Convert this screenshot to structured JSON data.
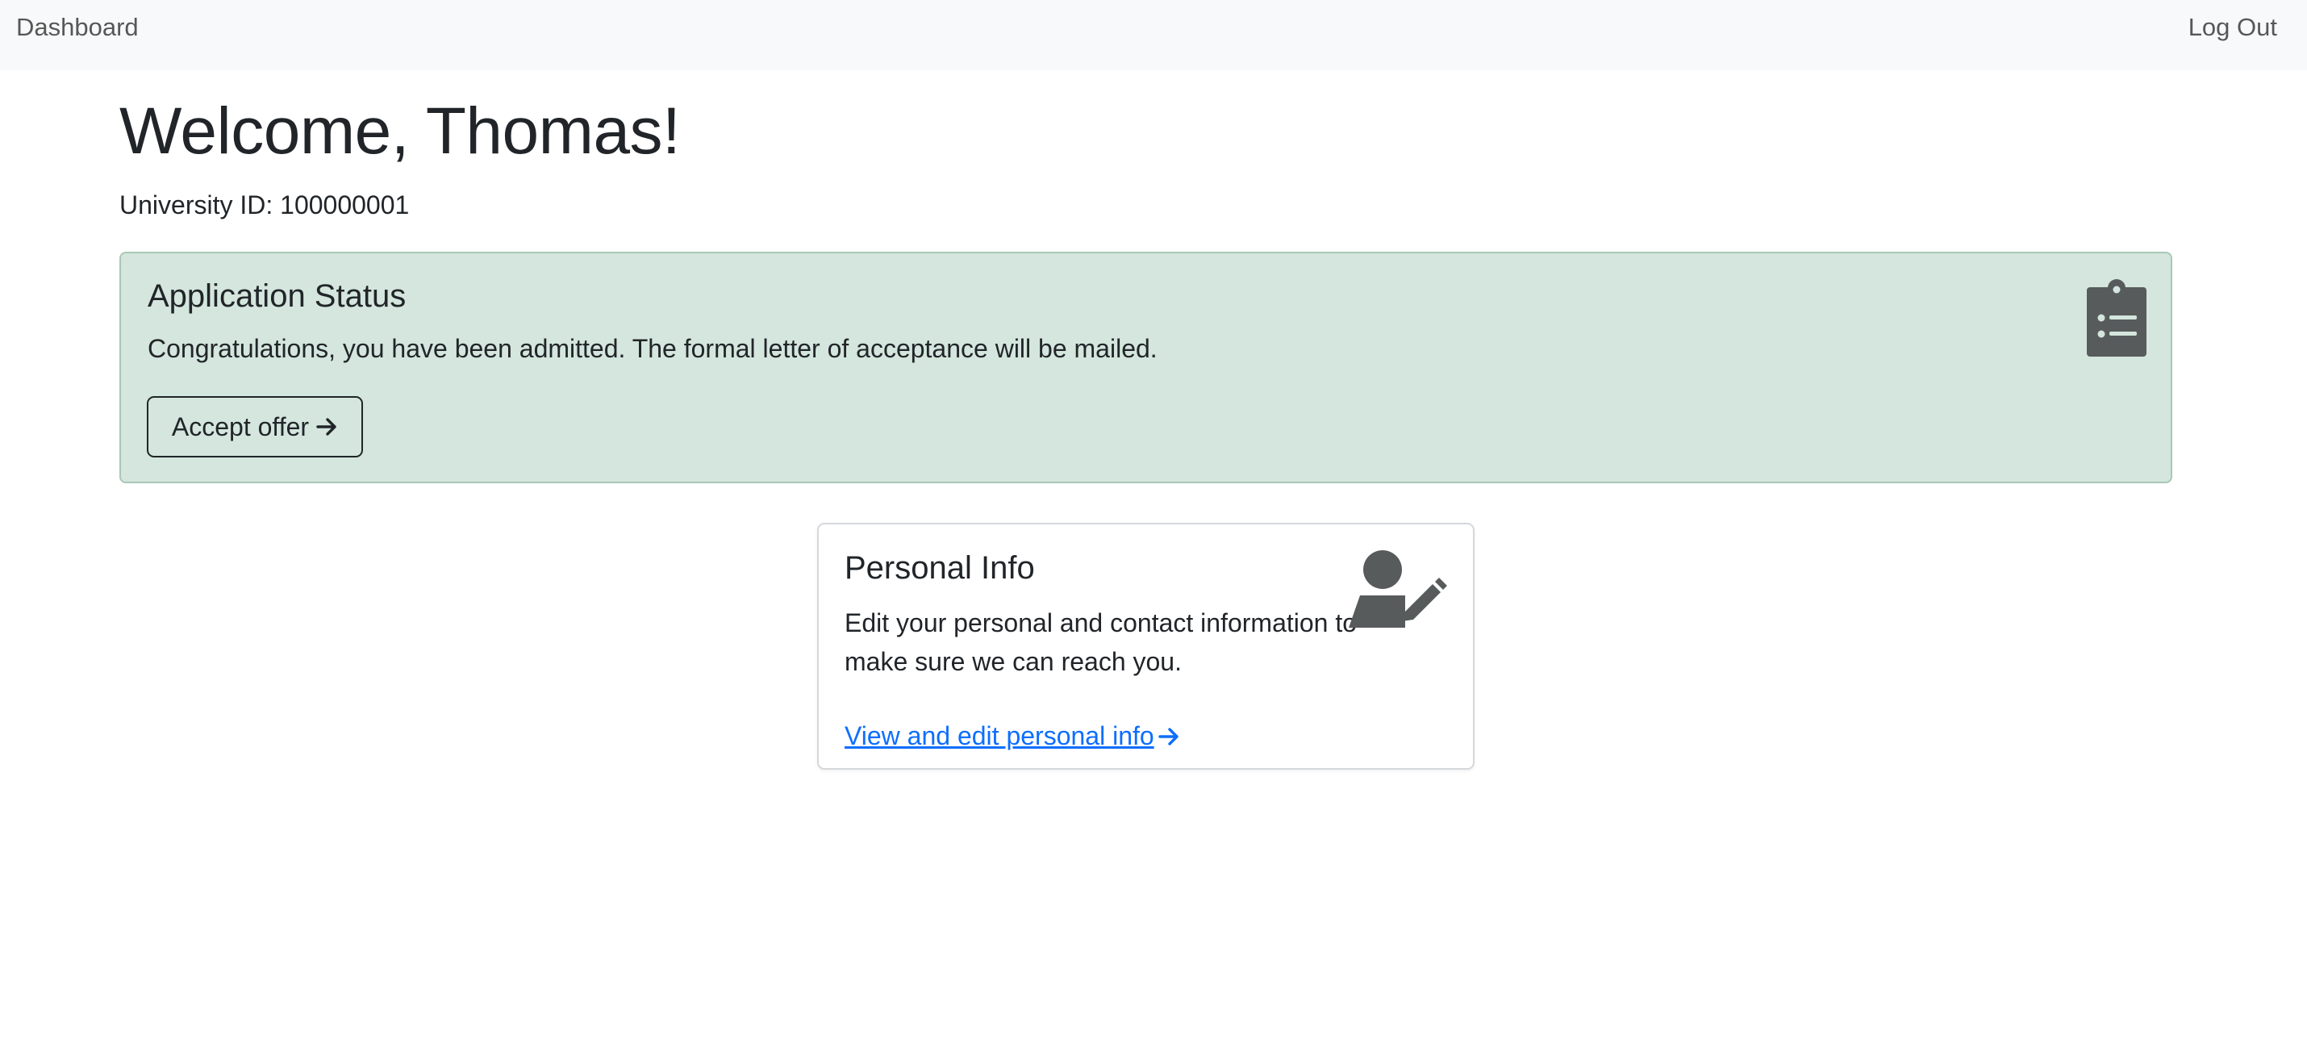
{
  "nav": {
    "brand": "Dashboard",
    "logout": "Log Out"
  },
  "header": {
    "welcome": "Welcome, Thomas!",
    "university_id": "University ID: 100000001"
  },
  "status_card": {
    "title": "Application Status",
    "message": "Congratulations, you have been admitted. The formal letter of acceptance will be mailed.",
    "button_label": "Accept offer",
    "icon": "clipboard-list-icon",
    "bg_color": "#d4e6dd"
  },
  "info_card": {
    "title": "Personal Info",
    "description": "Edit your personal and contact information to make sure we can reach you.",
    "link_label": "View and edit personal info",
    "icon": "user-pen-icon",
    "link_color": "#0d6efd"
  }
}
